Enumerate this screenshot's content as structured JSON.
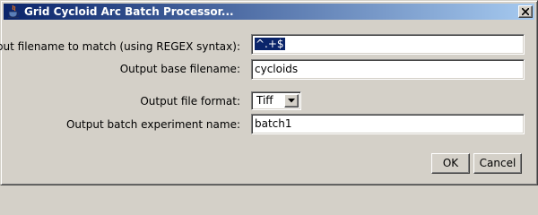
{
  "window": {
    "title": "Grid Cycloid Arc Batch Processor...",
    "icon": "java-cup-icon",
    "close_glyph": "close-icon"
  },
  "form": {
    "input_pattern": {
      "label": "Input filename to match (using REGEX syntax):",
      "value": "^.+$"
    },
    "output_base": {
      "label": "Output base filename:",
      "value": "cycloids"
    },
    "output_format": {
      "label": "Output file format:",
      "value": "Tiff"
    },
    "batch_name": {
      "label": "Output batch experiment name:",
      "value": "batch1"
    }
  },
  "buttons": {
    "ok": "OK",
    "cancel": "Cancel"
  },
  "colors": {
    "titlebar_start": "#0a246a",
    "titlebar_end": "#a6caf0",
    "dialog_bg": "#d4d0c8",
    "selection": "#0a246a"
  }
}
